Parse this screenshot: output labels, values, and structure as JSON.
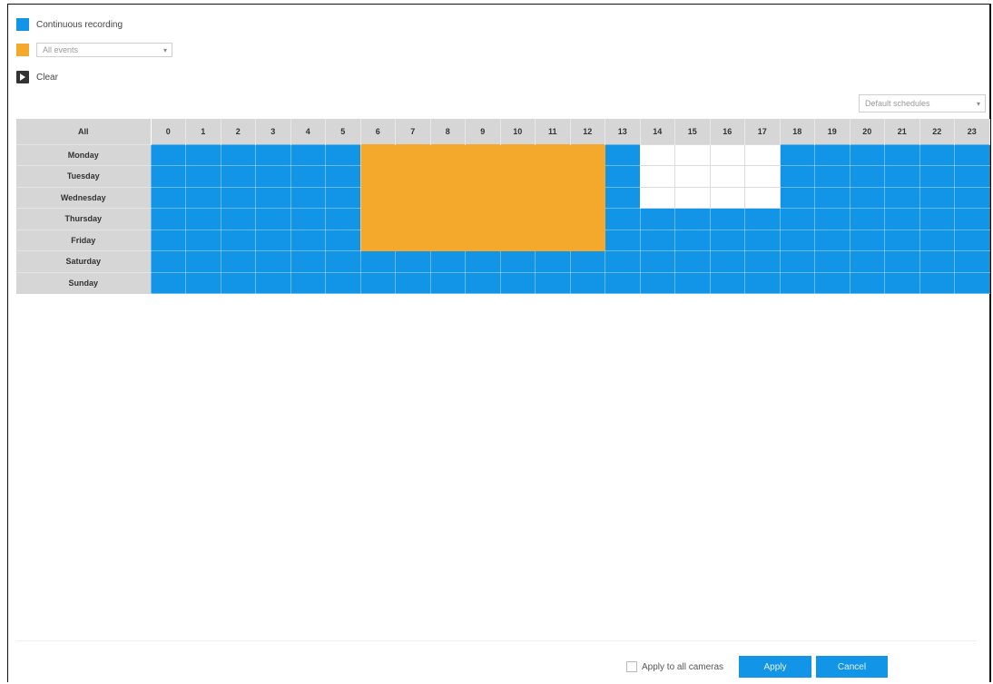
{
  "legend": {
    "continuous_label": "Continuous recording",
    "continuous_color": "#1295e6",
    "event_select_value": "All events",
    "event_color": "#f4a82c",
    "clear_label": "Clear"
  },
  "schedule_select": {
    "value": "Default schedules"
  },
  "grid": {
    "corner_label": "All",
    "hours": [
      "0",
      "1",
      "2",
      "3",
      "4",
      "5",
      "6",
      "7",
      "8",
      "9",
      "10",
      "11",
      "12",
      "13",
      "14",
      "15",
      "16",
      "17",
      "18",
      "19",
      "20",
      "21",
      "22",
      "23"
    ],
    "days": [
      "Monday",
      "Tuesday",
      "Wednesday",
      "Thursday",
      "Friday",
      "Saturday",
      "Sunday"
    ],
    "cells": [
      "BBBBBBBOOOOOOOBWWWWBBBBBB",
      "BBBBBBBOOOOOOOBWWWWBBBBBB",
      "BBBBBBBOOOOOOOBWWWWBBBBBB",
      "BBBBBBBOOOOOOOBBBBBBBBBBB",
      "BBBBBBBOOOOOOOBBBBBBBBBBB",
      "BBBBBBBBBBBBBBBBBBBBBBBBB",
      "BBBBBBBBBBBBBBBBBBBBBBBBB"
    ]
  },
  "footer": {
    "apply_all_label": "Apply to all cameras",
    "apply_label": "Apply",
    "cancel_label": "Cancel"
  }
}
